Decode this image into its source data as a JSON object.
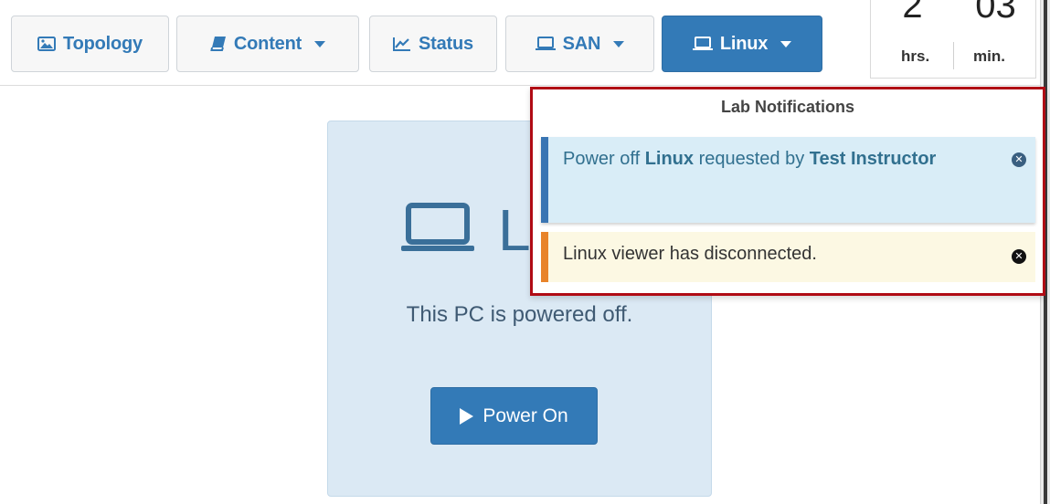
{
  "toolbar": {
    "topology": "Topology",
    "content": "Content",
    "status": "Status",
    "san": "SAN",
    "linux": "Linux"
  },
  "timer": {
    "hours": "2",
    "minutes": "03",
    "hours_label": "hrs.",
    "minutes_label": "min."
  },
  "card": {
    "title_partial": "L",
    "message": "This PC is powered off.",
    "power_on_label": "Power On"
  },
  "notifications": {
    "title": "Lab Notifications",
    "items": [
      {
        "type": "info",
        "text_pre": "Power off ",
        "device": "Linux",
        "text_mid": " requested by ",
        "user": "Test Instructor"
      },
      {
        "type": "warning",
        "text": "Linux viewer has disconnected."
      }
    ]
  },
  "colors": {
    "primary": "#337ab7",
    "info_bg": "#d9edf7",
    "warning_bg": "#fcf8e3",
    "highlight_border": "#b00b14"
  }
}
